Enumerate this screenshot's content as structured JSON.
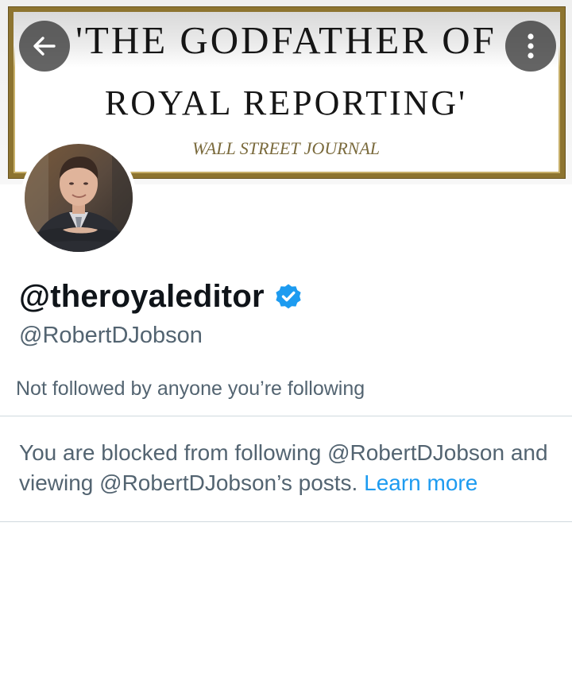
{
  "banner": {
    "line1": "'THE GODFATHER OF",
    "line2": "ROYAL REPORTING'",
    "line3": "WALL STREET JOURNAL"
  },
  "header": {
    "back_icon": "arrow-left-icon",
    "more_icon": "vertical-ellipsis-icon"
  },
  "profile": {
    "display_name": "@theroyaleditor",
    "verified_icon": "verified-badge-icon",
    "handle": "@RobertDJobson",
    "followed_note": "Not followed by anyone you’re following"
  },
  "blocked_notice": {
    "text": "You are blocked from following @RobertDJobson and viewing @RobertDJobson’s posts.",
    "link_label": "Learn more"
  },
  "colors": {
    "primary_text": "#0f1419",
    "secondary_text": "#536471",
    "link": "#1d9bf0",
    "verified": "#1d9bf0",
    "banner_gold": "#8d7430"
  }
}
